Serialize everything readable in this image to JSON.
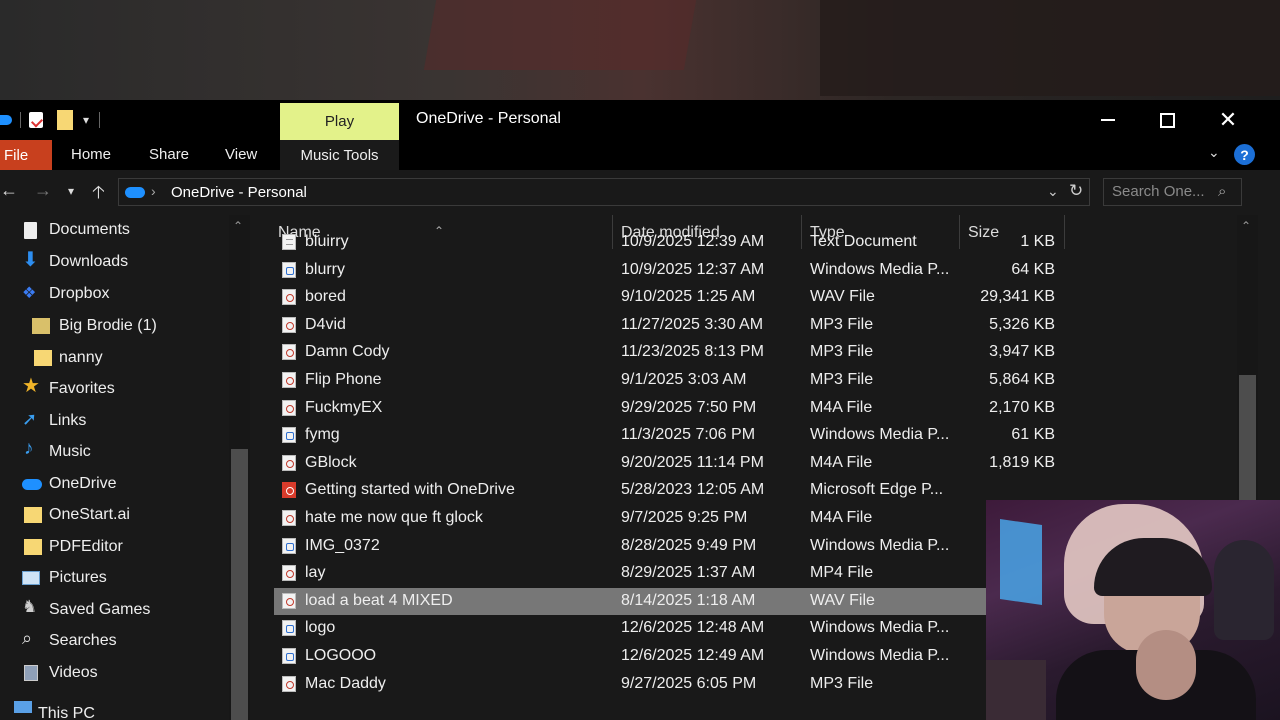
{
  "window": {
    "title": "OneDrive - Personal",
    "context_tab": "Play",
    "controls": {
      "minimize": "minimize",
      "maximize": "maximize",
      "close": "close"
    }
  },
  "ribbon": {
    "tabs": [
      "File",
      "Home",
      "Share",
      "View",
      "Music Tools"
    ],
    "help": "?"
  },
  "address": {
    "path": "OneDrive - Personal",
    "separator": "›",
    "search_placeholder": "Search One..."
  },
  "navpane": {
    "items": [
      {
        "label": "Documents",
        "icon": "documents-icon"
      },
      {
        "label": "Downloads",
        "icon": "downloads-icon"
      },
      {
        "label": "Dropbox",
        "icon": "dropbox-icon"
      },
      {
        "label": "Big Brodie (1)",
        "icon": "folder-image-icon"
      },
      {
        "label": "nanny",
        "icon": "folder-icon"
      },
      {
        "label": "Favorites",
        "icon": "star-icon"
      },
      {
        "label": "Links",
        "icon": "links-icon"
      },
      {
        "label": "Music",
        "icon": "music-icon"
      },
      {
        "label": "OneDrive",
        "icon": "onedrive-icon"
      },
      {
        "label": "OneStart.ai",
        "icon": "folder-icon"
      },
      {
        "label": "PDFEditor",
        "icon": "folder-icon"
      },
      {
        "label": "Pictures",
        "icon": "pictures-icon"
      },
      {
        "label": "Saved Games",
        "icon": "saved-games-icon"
      },
      {
        "label": "Searches",
        "icon": "search-icon"
      },
      {
        "label": "Videos",
        "icon": "videos-icon"
      },
      {
        "label": "This PC",
        "icon": "computer-icon"
      }
    ]
  },
  "filelist": {
    "columns": [
      "Name",
      "Date modified",
      "Type",
      "Size"
    ],
    "rows": [
      {
        "name": "bluirry",
        "date": "10/9/2025 12:39 AM",
        "type": "Text Document",
        "size": "1 KB",
        "icon": "txt"
      },
      {
        "name": "blurry",
        "date": "10/9/2025 12:37 AM",
        "type": "Windows Media P...",
        "size": "64 KB",
        "icon": "wmp"
      },
      {
        "name": "bored",
        "date": "9/10/2025 1:25 AM",
        "type": "WAV File",
        "size": "29,341 KB",
        "icon": "audio"
      },
      {
        "name": "D4vid",
        "date": "11/27/2025 3:30 AM",
        "type": "MP3 File",
        "size": "5,326 KB",
        "icon": "audio"
      },
      {
        "name": "Damn Cody",
        "date": "11/23/2025 8:13 PM",
        "type": "MP3 File",
        "size": "3,947 KB",
        "icon": "audio"
      },
      {
        "name": "Flip Phone",
        "date": "9/1/2025 3:03 AM",
        "type": "MP3 File",
        "size": "5,864 KB",
        "icon": "audio"
      },
      {
        "name": "FuckmyEX",
        "date": "9/29/2025 7:50 PM",
        "type": "M4A File",
        "size": "2,170 KB",
        "icon": "audio"
      },
      {
        "name": "fymg",
        "date": "11/3/2025 7:06 PM",
        "type": "Windows Media P...",
        "size": "61 KB",
        "icon": "wmp"
      },
      {
        "name": "GBlock",
        "date": "9/20/2025 11:14 PM",
        "type": "M4A File",
        "size": "1,819 KB",
        "icon": "audio"
      },
      {
        "name": "Getting started with OneDrive",
        "date": "5/28/2023 12:05 AM",
        "type": "Microsoft Edge P...",
        "size": "",
        "icon": "pdf"
      },
      {
        "name": "hate me now que ft glock",
        "date": "9/7/2025 9:25 PM",
        "type": "M4A File",
        "size": "",
        "icon": "audio"
      },
      {
        "name": "IMG_0372",
        "date": "8/28/2025 9:49 PM",
        "type": "Windows Media P...",
        "size": "",
        "icon": "wmp"
      },
      {
        "name": "lay",
        "date": "8/29/2025 1:37 AM",
        "type": "MP4 File",
        "size": "",
        "icon": "audio"
      },
      {
        "name": "load a beat 4 MIXED",
        "date": "8/14/2025 1:18 AM",
        "type": "WAV File",
        "size": "",
        "icon": "audio",
        "selected": true
      },
      {
        "name": "logo",
        "date": "12/6/2025 12:48 AM",
        "type": "Windows Media P...",
        "size": "",
        "icon": "wmp"
      },
      {
        "name": "LOGOOO",
        "date": "12/6/2025 12:49 AM",
        "type": "Windows Media P...",
        "size": "",
        "icon": "wmp"
      },
      {
        "name": "Mac Daddy",
        "date": "9/27/2025 6:05 PM",
        "type": "MP3 File",
        "size": "",
        "icon": "audio"
      }
    ]
  },
  "colors": {
    "accent_file_tab": "#c8401e",
    "context_tab": "#e3f28a",
    "help": "#1c6fd6",
    "selection": "#777777"
  }
}
